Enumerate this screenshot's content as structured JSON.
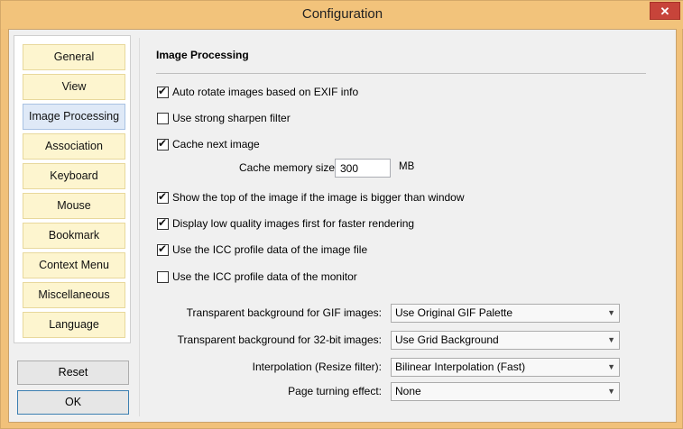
{
  "window": {
    "title": "Configuration",
    "close_glyph": "✕"
  },
  "nav": {
    "items": [
      {
        "label": "General",
        "active": false
      },
      {
        "label": "View",
        "active": false
      },
      {
        "label": "Image Processing",
        "active": true
      },
      {
        "label": "Association",
        "active": false
      },
      {
        "label": "Keyboard",
        "active": false
      },
      {
        "label": "Mouse",
        "active": false
      },
      {
        "label": "Bookmark",
        "active": false
      },
      {
        "label": "Context Menu",
        "active": false
      },
      {
        "label": "Miscellaneous",
        "active": false
      },
      {
        "label": "Language",
        "active": false
      }
    ]
  },
  "buttons": {
    "reset": "Reset",
    "ok": "OK"
  },
  "section": {
    "title": "Image Processing",
    "options": [
      {
        "label": "Auto rotate images based on EXIF info",
        "checked": true
      },
      {
        "label": "Use strong sharpen filter",
        "checked": false
      },
      {
        "label": "Cache next image",
        "checked": true
      },
      {
        "label": "Show the top of the image if the image is bigger than window",
        "checked": true
      },
      {
        "label": "Display low quality images first for faster rendering",
        "checked": true
      },
      {
        "label": "Use the ICC profile data of the image file",
        "checked": true
      },
      {
        "label": "Use the ICC profile data of the monitor",
        "checked": false
      }
    ],
    "cache": {
      "label": "Cache memory size:",
      "value": "300",
      "unit": "MB"
    },
    "dropdowns": [
      {
        "label": "Transparent background for GIF images:",
        "value": "Use Original GIF Palette"
      },
      {
        "label": "Transparent background for 32-bit images:",
        "value": "Use Grid Background"
      },
      {
        "label": "Interpolation (Resize filter):",
        "value": "Bilinear Interpolation (Fast)"
      },
      {
        "label": "Page turning effect:",
        "value": "None"
      }
    ]
  }
}
